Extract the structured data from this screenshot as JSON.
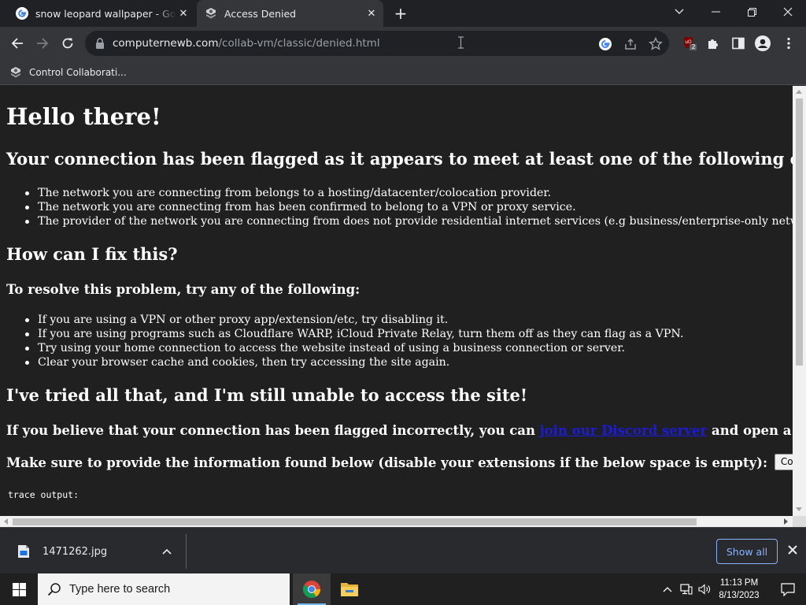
{
  "browser": {
    "tabs": [
      {
        "title": "snow leopard wallpaper - Google",
        "favicon": "google-icon",
        "active": false
      },
      {
        "title": "Access Denied",
        "favicon": "collabvm-icon",
        "active": true
      }
    ],
    "address": {
      "domain": "computernewb.com",
      "path": "/collab-vm/classic/denied.html"
    },
    "extension_badge": "2",
    "bookmarks": [
      {
        "label": "Control Collaborati...",
        "favicon": "collabvm-icon"
      }
    ]
  },
  "page": {
    "h1": "Hello there!",
    "criteria_heading": "Your connection has been flagged as it appears to meet at least one of the following criteria:",
    "criteria": [
      "The network you are connecting from belongs to a hosting/datacenter/colocation provider.",
      "The network you are connecting from has been confirmed to belong to a VPN or proxy service.",
      "The provider of the network you are connecting from does not provide residential internet services (e.g business/enterprise-only networks)."
    ],
    "fix_heading": "How can I fix this?",
    "resolve_heading": "To resolve this problem, try any of the following:",
    "fixes": [
      "If you are using a VPN or other proxy app/extension/etc, try disabling it.",
      "If you are using programs such as Cloudflare WARP, iCloud Private Relay, turn them off as they can flag as a VPN.",
      "Try using your home connection to access the website instead of using a business connection or server.",
      "Clear your browser cache and cookies, then try accessing the site again."
    ],
    "still_heading": "I've tried all that, and I'm still unable to access the site!",
    "incorrect_before": "If you believe that your connection has been flagged incorrectly, you can ",
    "discord_link": "join our Discord server",
    "incorrect_after": " and open a ticket.",
    "provide_text": "Make sure to provide the information found below (disable your extensions if the below space is empty):",
    "copy_button": "Copy to clipboard",
    "trace_label": "trace output:"
  },
  "downloads": {
    "file_name": "1471262.jpg",
    "show_all": "Show all"
  },
  "taskbar": {
    "search_placeholder": "Type here to search",
    "time": "11:13 PM",
    "date": "8/13/2023"
  },
  "colors": {
    "page_bg": "#202020",
    "link": "#1b1bd9",
    "accent": "#8ab4f8"
  }
}
